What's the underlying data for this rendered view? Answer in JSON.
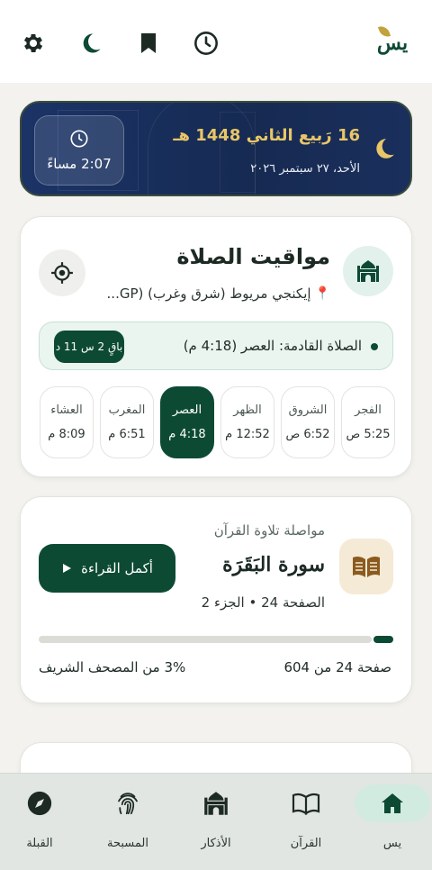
{
  "topbar": {
    "icons": [
      "settings-icon",
      "moon-icon",
      "bookmark-icon",
      "clock-icon"
    ],
    "logo": "يس"
  },
  "banner": {
    "time": "2:07 مساءً",
    "hijri": "16 رَبيع الثاني 1448 هـ",
    "gregorian": "الأحد، ٢٧ سبتمبر ٢٠٢٦"
  },
  "prayer_card": {
    "title": "مواقيت الصلاة",
    "location": "إيكنجي مريوط (شرق وغرب) (GP...",
    "next_prayer": "الصلاة القادمة: العصر (4:18 م)",
    "remaining": "باقٍ 2 س 11 د",
    "prayers": [
      {
        "name": "الفجر",
        "time": "5:25 ص"
      },
      {
        "name": "الشروق",
        "time": "6:52 ص"
      },
      {
        "name": "الظهر",
        "time": "12:52 م"
      },
      {
        "name": "العصر",
        "time": "4:18 م"
      },
      {
        "name": "المغرب",
        "time": "6:51 م"
      },
      {
        "name": "العشاء",
        "time": "8:09 م"
      }
    ],
    "active_prayer": "العصر"
  },
  "quran_card": {
    "label": "مواصلة تلاوة القرآن",
    "surah": "سورة البَقَرَة",
    "page_part": "الصفحة 24 • الجزء 2",
    "continue_label": "أكمل القراءة",
    "progress_percent": 3,
    "page_of_total": "صفحة 24 من 604",
    "percent_text": "3% من المصحف الشريف"
  },
  "bottom_nav": {
    "items": [
      {
        "label": "يس",
        "icon": "home-icon",
        "active": true
      },
      {
        "label": "القرآن",
        "icon": "book-icon",
        "active": false
      },
      {
        "label": "الأذكار",
        "icon": "mosque-icon",
        "active": false
      },
      {
        "label": "المسبحة",
        "icon": "fingerprint-icon",
        "active": false
      },
      {
        "label": "القبلة",
        "icon": "compass-icon",
        "active": false
      }
    ]
  },
  "colors": {
    "primary": "#0d4a34",
    "gold": "#e9c667",
    "banner": "#1b3366"
  }
}
